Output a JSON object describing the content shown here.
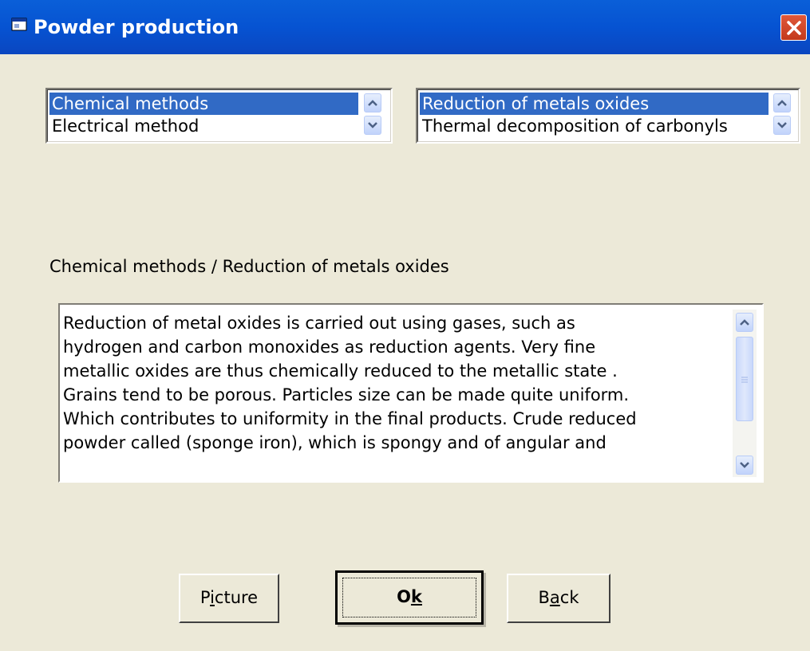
{
  "window": {
    "title": "Powder production",
    "colors": {
      "titlebar": "#0653d2",
      "face": "#ece9d8",
      "selection": "#316ac5",
      "close": "#d2462a"
    }
  },
  "list_left": {
    "items": [
      "Chemical methods",
      "Electrical method"
    ],
    "selected": 0
  },
  "list_right": {
    "items": [
      "Reduction of metals oxides",
      "Thermal decomposition of carbonyls"
    ],
    "selected": 0
  },
  "caption": "Chemical methods / Reduction of metals oxides",
  "description": {
    "lines": [
      "Reduction of metal oxides is carried out using gases, such as",
      "hydrogen and carbon monoxides as reduction agents. Very fine",
      "metallic oxides are thus chemically reduced to the metallic state .",
      "Grains tend to be porous. Particles size can be made quite uniform.",
      "Which contributes to uniformity in the final products. Crude reduced",
      "powder called (sponge iron), which is spongy and of angular and"
    ]
  },
  "buttons": {
    "picture": {
      "pre": "P",
      "acc": "i",
      "post": "cture"
    },
    "ok": {
      "pre": "O",
      "acc": "k",
      "post": ""
    },
    "back": {
      "pre": "B",
      "acc": "a",
      "post": "ck"
    }
  },
  "icons": [
    "window-icon",
    "close-icon",
    "scroll-up-icon",
    "scroll-down-icon"
  ]
}
